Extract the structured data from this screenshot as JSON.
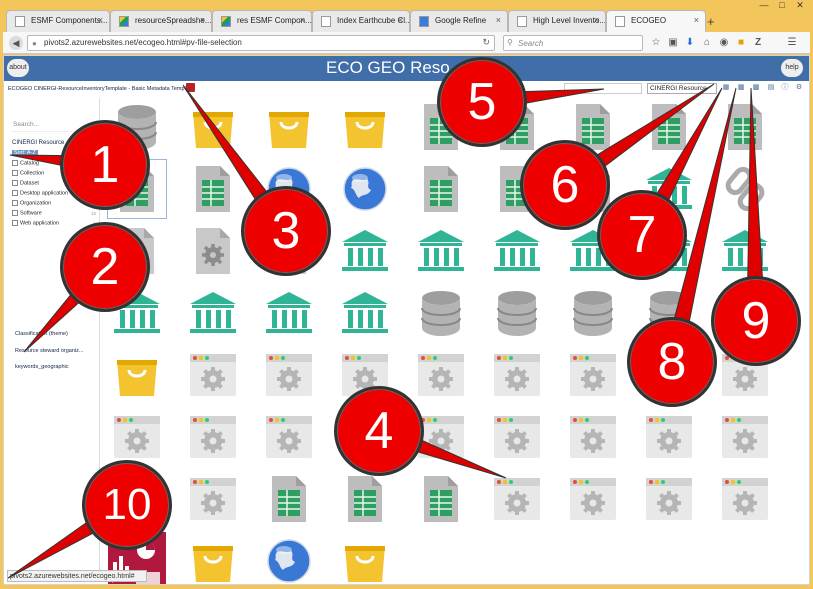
{
  "tabs": [
    {
      "label": "ESMF Components...",
      "icon": "doc-icon"
    },
    {
      "label": "resourceSpreadshe...",
      "icon": "drive-icon"
    },
    {
      "label": "res ESMF Compon...",
      "icon": "drive-icon"
    },
    {
      "label": "Index Earthcube Cl...",
      "icon": "doc-icon"
    },
    {
      "label": "Google Refine",
      "icon": "refine-icon"
    },
    {
      "label": "High Level Invento...",
      "icon": "doc-icon"
    },
    {
      "label": "ECOGEO",
      "icon": "doc-icon"
    }
  ],
  "nav": {
    "url": "pivots2.azurewebsites.net/ecogeo.html#pv-file-selection",
    "search_placeholder": "Search"
  },
  "page": {
    "title": "ECO GEO Reso",
    "about_label": "about",
    "help_label": "help",
    "breadcrumb": "ECOGEO CINERGI-ResourceInventoryTemplate - Basic Metadata Template",
    "view_select": "CINERGI Resource"
  },
  "sidebar": {
    "search_placeholder": "Search...",
    "facet_title": "CINERGI Resource",
    "sort_label": "Sort: A-Z",
    "facets": [
      {
        "label": "Catalog",
        "count": "1"
      },
      {
        "label": "Collection",
        "count": "1"
      },
      {
        "label": "Dataset",
        "count": "1"
      },
      {
        "label": "Desktop application",
        "count": "1"
      },
      {
        "label": "Organization",
        "count": "1"
      },
      {
        "label": "Software",
        "count": "15"
      },
      {
        "label": "Web application",
        "count": "1"
      }
    ],
    "sections": [
      "Classification (theme)",
      "Resource steward organiz...",
      "keywords_geographic"
    ]
  },
  "status_url": "pivots2.azurewebsites.net/ecogeo.html#",
  "grid": [
    [
      "db",
      "bag",
      "bag",
      "bag",
      "sheet",
      "sheet",
      "sheet",
      "sheet",
      "sheet"
    ],
    [
      "sheet",
      "sheet",
      "globe",
      "globe",
      "sheet",
      "sheet",
      "sheet",
      "inst",
      "link"
    ],
    [
      "gear",
      "gear",
      "gear",
      "inst",
      "inst",
      "inst",
      "inst",
      "inst",
      "inst"
    ],
    [
      "inst",
      "inst",
      "inst",
      "inst",
      "db",
      "db",
      "db",
      "db",
      "sheet"
    ],
    [
      "bag",
      "app",
      "app",
      "app",
      "app",
      "app",
      "app",
      "app",
      "app"
    ],
    [
      "app",
      "app",
      "app",
      "app",
      "app",
      "app",
      "app",
      "app",
      "app"
    ],
    [
      "app",
      "app",
      "sheet",
      "sheet",
      "sheet",
      "app",
      "app",
      "app",
      "app"
    ],
    [
      "chart",
      "bag",
      "globe",
      "bag"
    ]
  ],
  "callouts": [
    "1",
    "2",
    "3",
    "4",
    "5",
    "6",
    "7",
    "8",
    "9",
    "10"
  ],
  "colors": {
    "banner": "#3f6ea8",
    "callout": "#ee0000",
    "sheet": "#3aa76d",
    "bag": "#f4c430",
    "inst": "#2fb596"
  }
}
